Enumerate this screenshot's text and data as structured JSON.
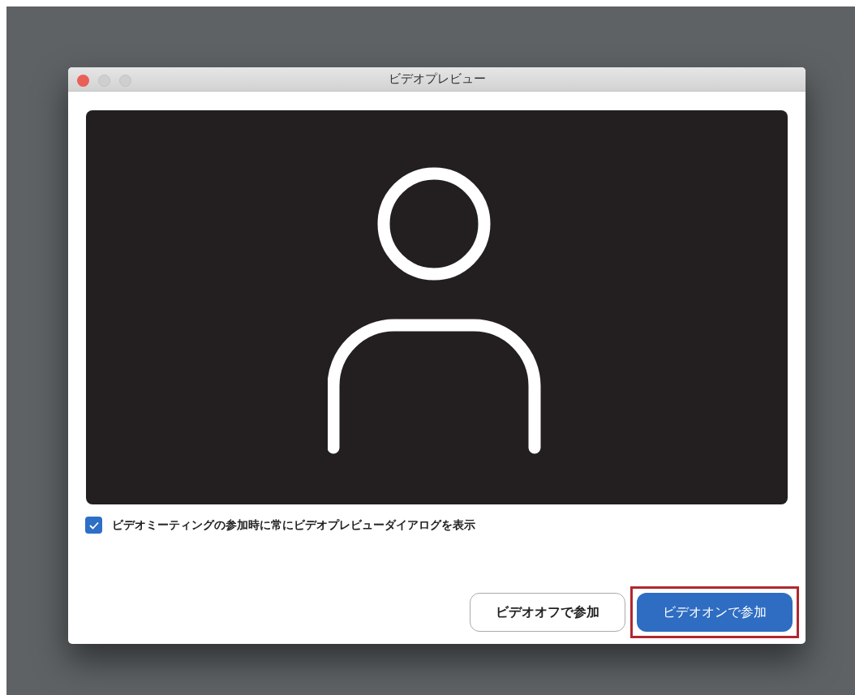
{
  "window": {
    "title": "ビデオプレビュー"
  },
  "preview": {
    "kind": "avatar"
  },
  "checkbox": {
    "label": "ビデオミーティングの参加時に常にビデオプレビューダイアログを表示",
    "checked": true
  },
  "buttons": [
    {
      "label": "ビデオオフで参加",
      "kind": "secondary",
      "highlighted": false
    },
    {
      "label": "ビデオオンで参加",
      "kind": "primary",
      "highlighted": true
    }
  ]
}
